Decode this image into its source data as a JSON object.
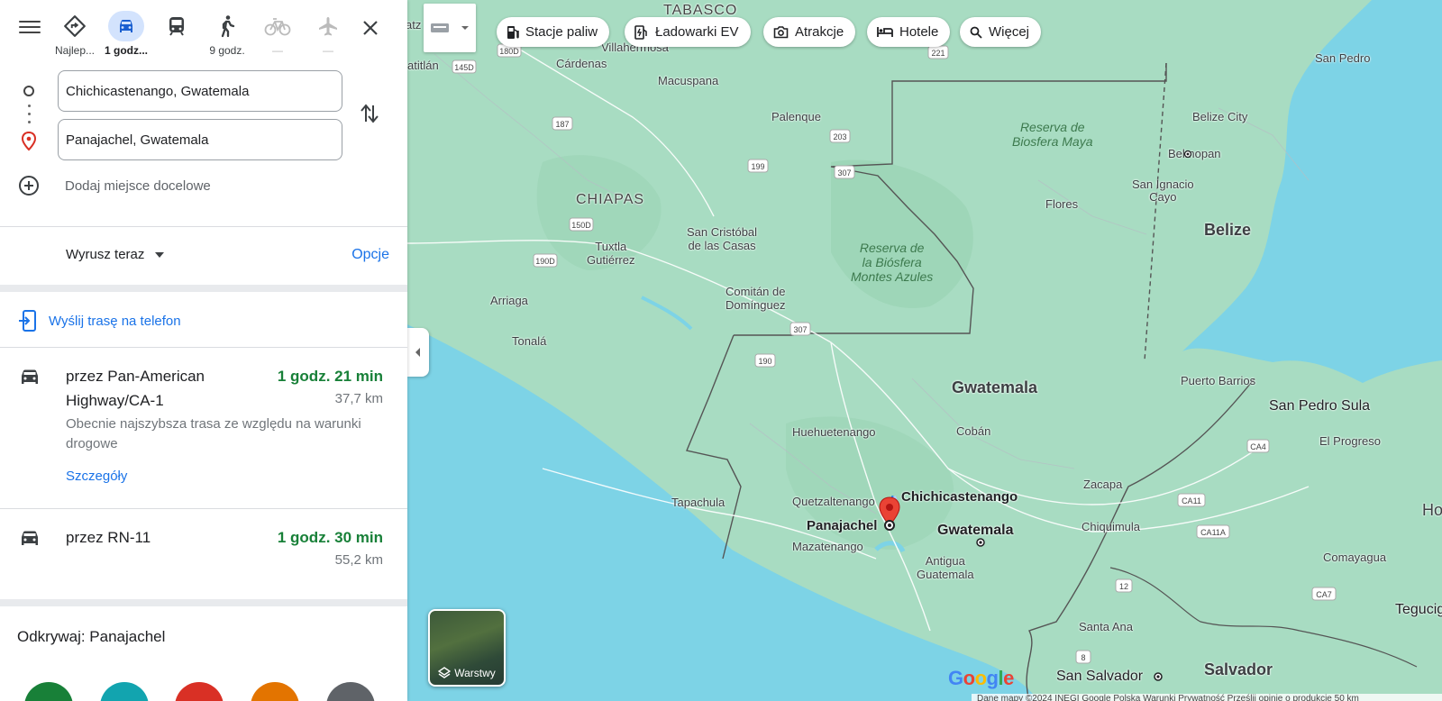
{
  "modes": [
    {
      "name": "best",
      "label": "Najlep...",
      "icon": "best-route-icon",
      "state": "normal"
    },
    {
      "name": "driving",
      "label": "1 godz...",
      "icon": "car-icon",
      "state": "active"
    },
    {
      "name": "transit",
      "label": "",
      "icon": "train-icon",
      "state": "normal"
    },
    {
      "name": "walking",
      "label": "9 godz.",
      "icon": "walk-icon",
      "state": "normal"
    },
    {
      "name": "cycling",
      "label": "—",
      "icon": "bike-icon",
      "state": "disabled"
    },
    {
      "name": "flight",
      "label": "—",
      "icon": "plane-icon",
      "state": "disabled"
    }
  ],
  "directions": {
    "origin": "Chichicastenango, Gwatemala",
    "destination": "Panajachel, Gwatemala",
    "add_destination": "Dodaj miejsce docelowe",
    "depart": "Wyrusz teraz",
    "options": "Opcje",
    "send_to_phone": "Wyślij trasę na telefon"
  },
  "routes": [
    {
      "via": "przez Pan-American Highway/CA-1",
      "time": "1 godz. 21 min",
      "distance": "37,7 km",
      "note": "Obecnie najszybsza trasa ze względu na warunki drogowe",
      "details": "Szczegóły"
    },
    {
      "via": "przez RN-11",
      "time": "1 godz. 30 min",
      "distance": "55,2 km"
    }
  ],
  "explore": "Odkrywaj: Panajachel",
  "explore_circle_colors": [
    "#188038",
    "#12a4af",
    "#d93025",
    "#e37400",
    "#5f6368"
  ],
  "chips": [
    {
      "label": "Stacje paliw",
      "icon": "gas-station-icon"
    },
    {
      "label": "Ładowarki EV",
      "icon": "ev-charger-icon"
    },
    {
      "label": "Atrakcje",
      "icon": "camera-icon"
    },
    {
      "label": "Hotele",
      "icon": "hotel-icon"
    },
    {
      "label": "Więcej",
      "icon": "search-icon"
    }
  ],
  "layers_label": "Warstwy",
  "map_labels": {
    "tabasco": "TABASCO",
    "chiapas": "CHIAPAS",
    "villahermosa": "Villahermosa",
    "atz": "atz",
    "atitlan": "atitlán",
    "cardenas": "Cárdenas",
    "macuspana": "Macuspana",
    "palenque": "Palenque",
    "san_cristobal": "San Cristóbal\nde las Casas",
    "tuxtla": "Tuxtla\nGutiérrez",
    "arriaga": "Arriaga",
    "tonala": "Tonalá",
    "comitan": "Comitán de\nDomínguez",
    "reserva_maya": "Reserva de\nBiosfera Maya",
    "reserva_montes": "Reserva de\nla Biósfera\nMontes Azules",
    "flores": "Flores",
    "san_pedro": "San Pedro",
    "belize_city": "Belize City",
    "belmopan": "Belmopan",
    "san_ignacio": "San Ignacio\nCayo",
    "belize": "Belize",
    "gwatemala_country": "Gwatemala",
    "huehuetenango": "Huehuetenango",
    "coban": "Cobán",
    "puerto_barrios": "Puerto Barrios",
    "san_pedro_sula": "San Pedro Sula",
    "el_progreso": "El Progreso",
    "zacapa": "Zacapa",
    "chiquimula": "Chiquimula",
    "quetzaltenango": "Quetzaltenango",
    "chichicastenango": "Chichicastenango",
    "panajachel": "Panajachel",
    "gwatemala_city": "Gwatemala",
    "mazatenango": "Mazatenango",
    "antigua": "Antigua\nGuatemala",
    "tapachula": "Tapachula",
    "comayagua": "Comayagua",
    "santa_ana": "Santa Ana",
    "san_salvador": "San Salvador",
    "salvador": "Salvador",
    "tegucigalpa": "Tegucig",
    "ho": "Ho"
  },
  "road_shields": [
    "145D",
    "180D",
    "187",
    "199",
    "203",
    "307",
    "221",
    "150D",
    "190D",
    "190",
    "307",
    "CA4",
    "CA11",
    "CA11A",
    "CA7",
    "12",
    "8"
  ],
  "attribution": "Dane mapy ©2024 INEGI Google    Polska    Warunki    Prywatność    Prześlij opinię o produkcie    50 km"
}
